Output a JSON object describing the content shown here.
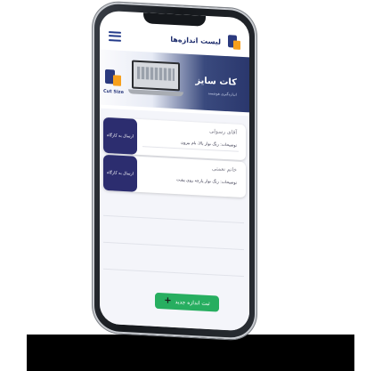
{
  "header": {
    "title": "لیست اندازه‌ها",
    "menu_icon": "hamburger-icon",
    "logo_icon": "app-logo-icon"
  },
  "banner": {
    "title": "کات سایز",
    "subtitle": "اندازه‌گیری هوشمند",
    "logo_text": "Cut Size"
  },
  "cards": [
    {
      "name": "آقای رسولی",
      "description": "توضیحات: رنگ نوار بالا، نام بیرون",
      "action_label": "ارسال به کارگاه"
    },
    {
      "name": "خانم نعمتی",
      "description": "توضیحات: رنگ نوار پارچه روی پشت",
      "action_label": "ارسال به کارگاه"
    }
  ],
  "add_button": {
    "label": "ثبت اندازه جدید",
    "icon": "plus-icon"
  },
  "colors": {
    "primary": "#2c2d6f",
    "accent": "#f7a01c",
    "success": "#27ae60"
  }
}
